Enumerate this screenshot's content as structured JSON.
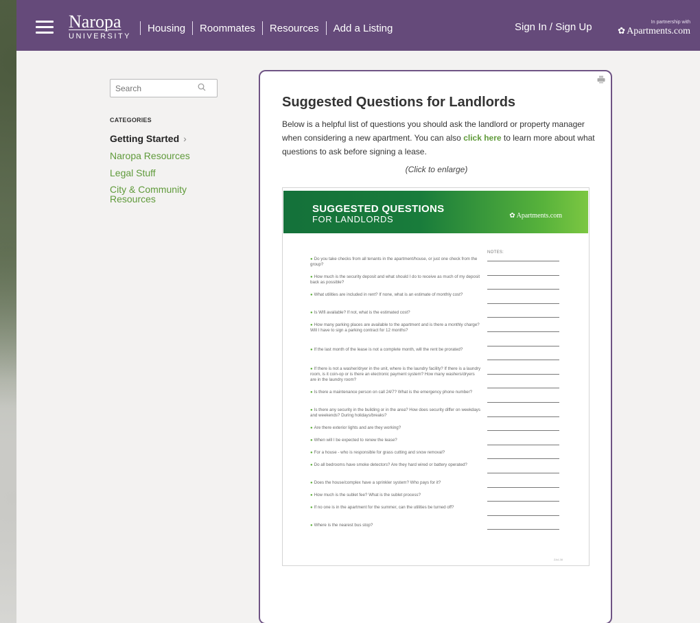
{
  "header": {
    "logo_name": "Naropa",
    "logo_sub": "UNIVERSITY",
    "nav": [
      "Housing",
      "Roommates",
      "Resources",
      "Add a Listing"
    ],
    "signin": "Sign In / Sign Up",
    "partner_small": "In partnership with",
    "partner_brand": "Apartments.com"
  },
  "sidebar": {
    "search_placeholder": "Search",
    "categories_heading": "CATEGORIES",
    "categories": [
      {
        "label": "Getting Started",
        "active": true,
        "chevron": "›"
      },
      {
        "label": "Naropa Resources"
      },
      {
        "label": "Legal Stuff"
      },
      {
        "label": "City & Community Resources"
      }
    ]
  },
  "main": {
    "title": "Suggested Questions for Landlords",
    "intro_before": "Below is a helpful list of questions you should ask the landlord or property manager when considering a new apartment. You can also ",
    "intro_link": "click here",
    "intro_after": " to learn more about what questions to ask before signing a lease.",
    "enlarge": "(Click to enlarge)"
  },
  "flyer": {
    "title_line1": "SUGGESTED QUESTIONS",
    "title_line2": "FOR LANDLORDS",
    "brand": "Apartments.com",
    "notes_label": "NOTES:",
    "footer": "ZA4-38",
    "questions": [
      "Do you take checks from all tenants in the apartment/house, or just one check from the group?",
      "How much is the security deposit and what should I do to receive as much of my deposit back as possible?",
      "What utilities are included in rent? If none, what is an estimate of monthly cost?",
      "Is Wifi available? If not, what is the estimated cost?",
      "How many parking places are available to the apartment and is there a monthly charge? Will I have to sign a parking contract for 12 months?",
      "If the last month of the lease is not a complete month, will the rent be prorated?",
      "If there is not a washer/dryer in the unit, where is the laundry facility? If there is a laundry room, is it coin-op or is there an electronic payment system? How many washers/dryers are in the laundry room?",
      "Is there a maintenance person on call 24/7? What is the emergency phone number?",
      "Is there any security in the building or in the area? How does security differ on weekdays and weekends? During holidays/breaks?",
      "Are there exterior lights and are they working?",
      "When will I be expected to renew the lease?",
      "For a house - who is responsible for grass cutting and snow removal?",
      "Do all bedrooms have smoke detectors? Are they hard wired or battery operated?",
      "Does the house/complex have a sprinkler system? Who pays for it?",
      "How much is the sublet fee? What is the sublet process?",
      "If no one is in the apartment for the summer, can the utilities be turned off?",
      "Where is the nearest bus stop?"
    ]
  }
}
